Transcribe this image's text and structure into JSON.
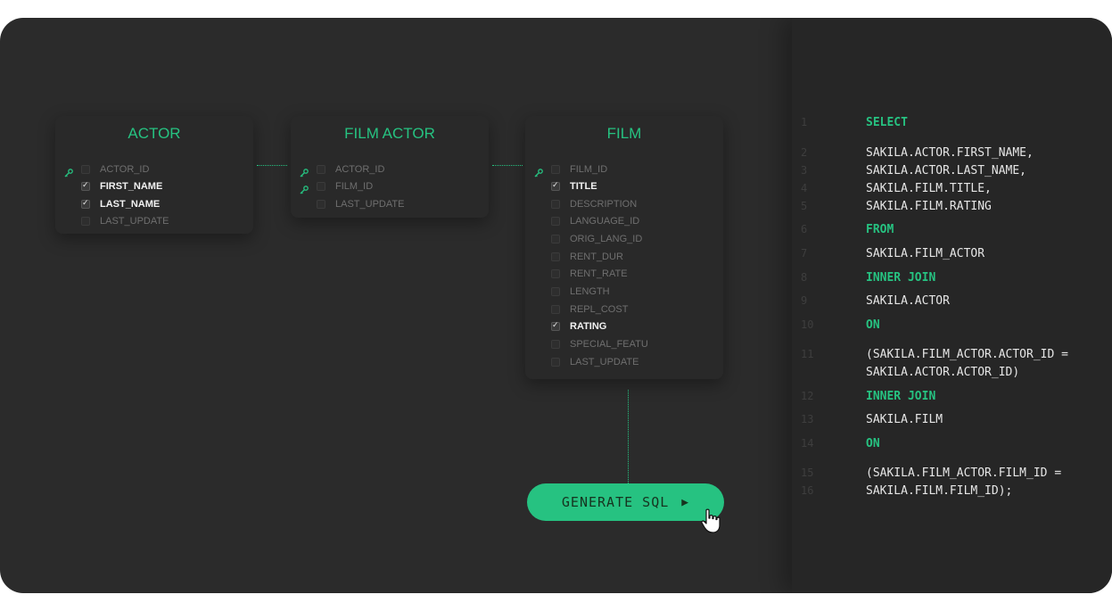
{
  "tables": [
    {
      "title": "ACTOR",
      "fields": [
        {
          "name": "ACTOR_ID",
          "checked": false,
          "key": true
        },
        {
          "name": "FIRST_NAME",
          "checked": true,
          "key": false
        },
        {
          "name": "LAST_NAME",
          "checked": true,
          "key": false
        },
        {
          "name": "LAST_UPDATE",
          "checked": false,
          "key": false
        }
      ]
    },
    {
      "title": "FILM ACTOR",
      "fields": [
        {
          "name": "ACTOR_ID",
          "checked": false,
          "key": true
        },
        {
          "name": "FILM_ID",
          "checked": false,
          "key": true
        },
        {
          "name": "LAST_UPDATE",
          "checked": false,
          "key": false
        }
      ]
    },
    {
      "title": "FILM",
      "fields": [
        {
          "name": "FILM_ID",
          "checked": false,
          "key": true
        },
        {
          "name": "TITLE",
          "checked": true,
          "key": false
        },
        {
          "name": "DESCRIPTION",
          "checked": false,
          "key": false
        },
        {
          "name": "LANGUAGE_ID",
          "checked": false,
          "key": false
        },
        {
          "name": "ORIG_LANG_ID",
          "checked": false,
          "key": false
        },
        {
          "name": "RENT_DUR",
          "checked": false,
          "key": false
        },
        {
          "name": "RENT_RATE",
          "checked": false,
          "key": false
        },
        {
          "name": "LENGTH",
          "checked": false,
          "key": false
        },
        {
          "name": "REPL_COST",
          "checked": false,
          "key": false
        },
        {
          "name": "RATING",
          "checked": true,
          "key": false
        },
        {
          "name": "SPECIAL_FEATU",
          "checked": false,
          "key": false
        },
        {
          "name": "LAST_UPDATE",
          "checked": false,
          "key": false
        }
      ]
    }
  ],
  "button": {
    "label": "GENERATE SQL",
    "icon": "play-icon"
  },
  "sql": {
    "line_numbers": [
      "1",
      "2",
      "3",
      "4",
      "5",
      "6",
      "7",
      "8",
      "9",
      "10",
      "11",
      "12",
      "13",
      "14",
      "15",
      "16"
    ],
    "lines": [
      {
        "text": "SELECT",
        "keyword": true
      },
      {
        "text": "SAKILA.ACTOR.FIRST_NAME,",
        "keyword": false
      },
      {
        "text": "SAKILA.ACTOR.LAST_NAME,",
        "keyword": false
      },
      {
        "text": "SAKILA.FILM.TITLE,",
        "keyword": false
      },
      {
        "text": "SAKILA.FILM.RATING",
        "keyword": false
      },
      {
        "text": "FROM",
        "keyword": true
      },
      {
        "text": "SAKILA.FILM_ACTOR",
        "keyword": false
      },
      {
        "text": "INNER JOIN",
        "keyword": true
      },
      {
        "text": "SAKILA.ACTOR",
        "keyword": false
      },
      {
        "text": "ON",
        "keyword": true
      },
      {
        "text": "(SAKILA.FILM_ACTOR.ACTOR_ID =",
        "keyword": false
      },
      {
        "text": "SAKILA.ACTOR.ACTOR_ID)",
        "keyword": false
      },
      {
        "text": "INNER JOIN",
        "keyword": true
      },
      {
        "text": "SAKILA.FILM",
        "keyword": false
      },
      {
        "text": "ON",
        "keyword": true
      },
      {
        "text": "(SAKILA.FILM_ACTOR.FILM_ID =",
        "keyword": false
      },
      {
        "text": "SAKILA.FILM.FILM_ID);",
        "keyword": false
      }
    ]
  },
  "colors": {
    "accent": "#26c281",
    "background": "#2b2b2b",
    "panel": "#262626"
  }
}
